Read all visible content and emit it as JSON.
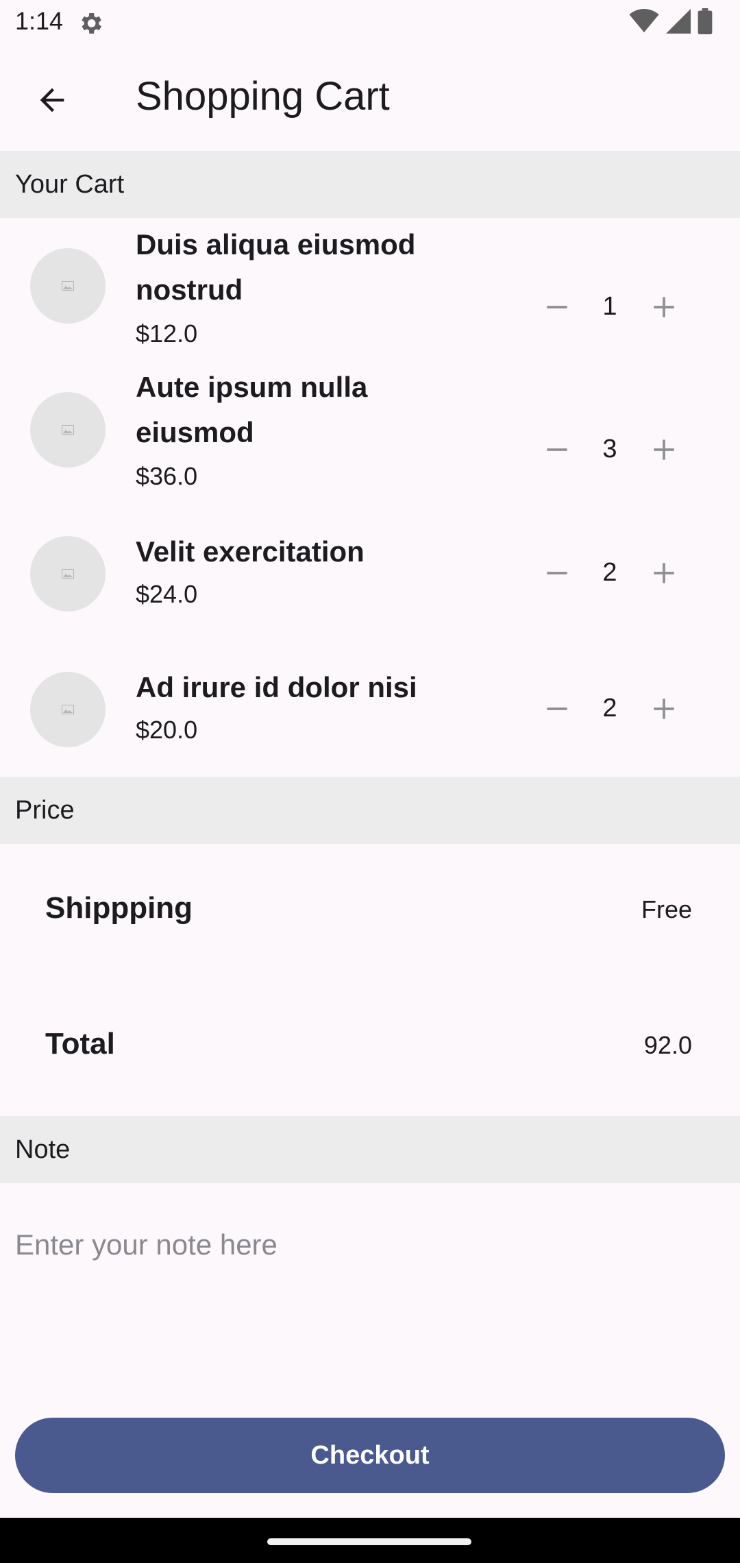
{
  "status_bar": {
    "time": "1:14",
    "settings_icon": "gear-icon",
    "wifi_icon": "wifi-icon",
    "signal_icon": "cell-signal-icon",
    "battery_icon": "battery-icon"
  },
  "app_bar": {
    "back_icon": "arrow-back-icon",
    "title": "Shopping Cart"
  },
  "sections": {
    "cart_header": "Your Cart",
    "price_header": "Price",
    "note_header": "Note"
  },
  "cart": {
    "items": [
      {
        "name": "Duis aliqua eiusmod nostrud",
        "price": "$12.0",
        "quantity": "1"
      },
      {
        "name": "Aute ipsum nulla eiusmod",
        "price": "$36.0",
        "quantity": "3"
      },
      {
        "name": "Velit exercitation",
        "price": "$24.0",
        "quantity": "2"
      },
      {
        "name": "Ad irure id dolor nisi",
        "price": "$20.0",
        "quantity": "2"
      }
    ],
    "thumbnail_icon": "image-placeholder-icon",
    "decrement_icon": "minus-icon",
    "increment_icon": "plus-icon"
  },
  "price": {
    "shipping_label": "Shippping",
    "shipping_value": "Free",
    "total_label": "Total",
    "total_value": "92.0"
  },
  "note": {
    "placeholder": "Enter your note here",
    "value": ""
  },
  "checkout": {
    "label": "Checkout"
  },
  "colors": {
    "background": "#fcf8fc",
    "section_header": "#ececec",
    "accent": "#4a5a8e",
    "control_gray": "#8f8f8f"
  }
}
